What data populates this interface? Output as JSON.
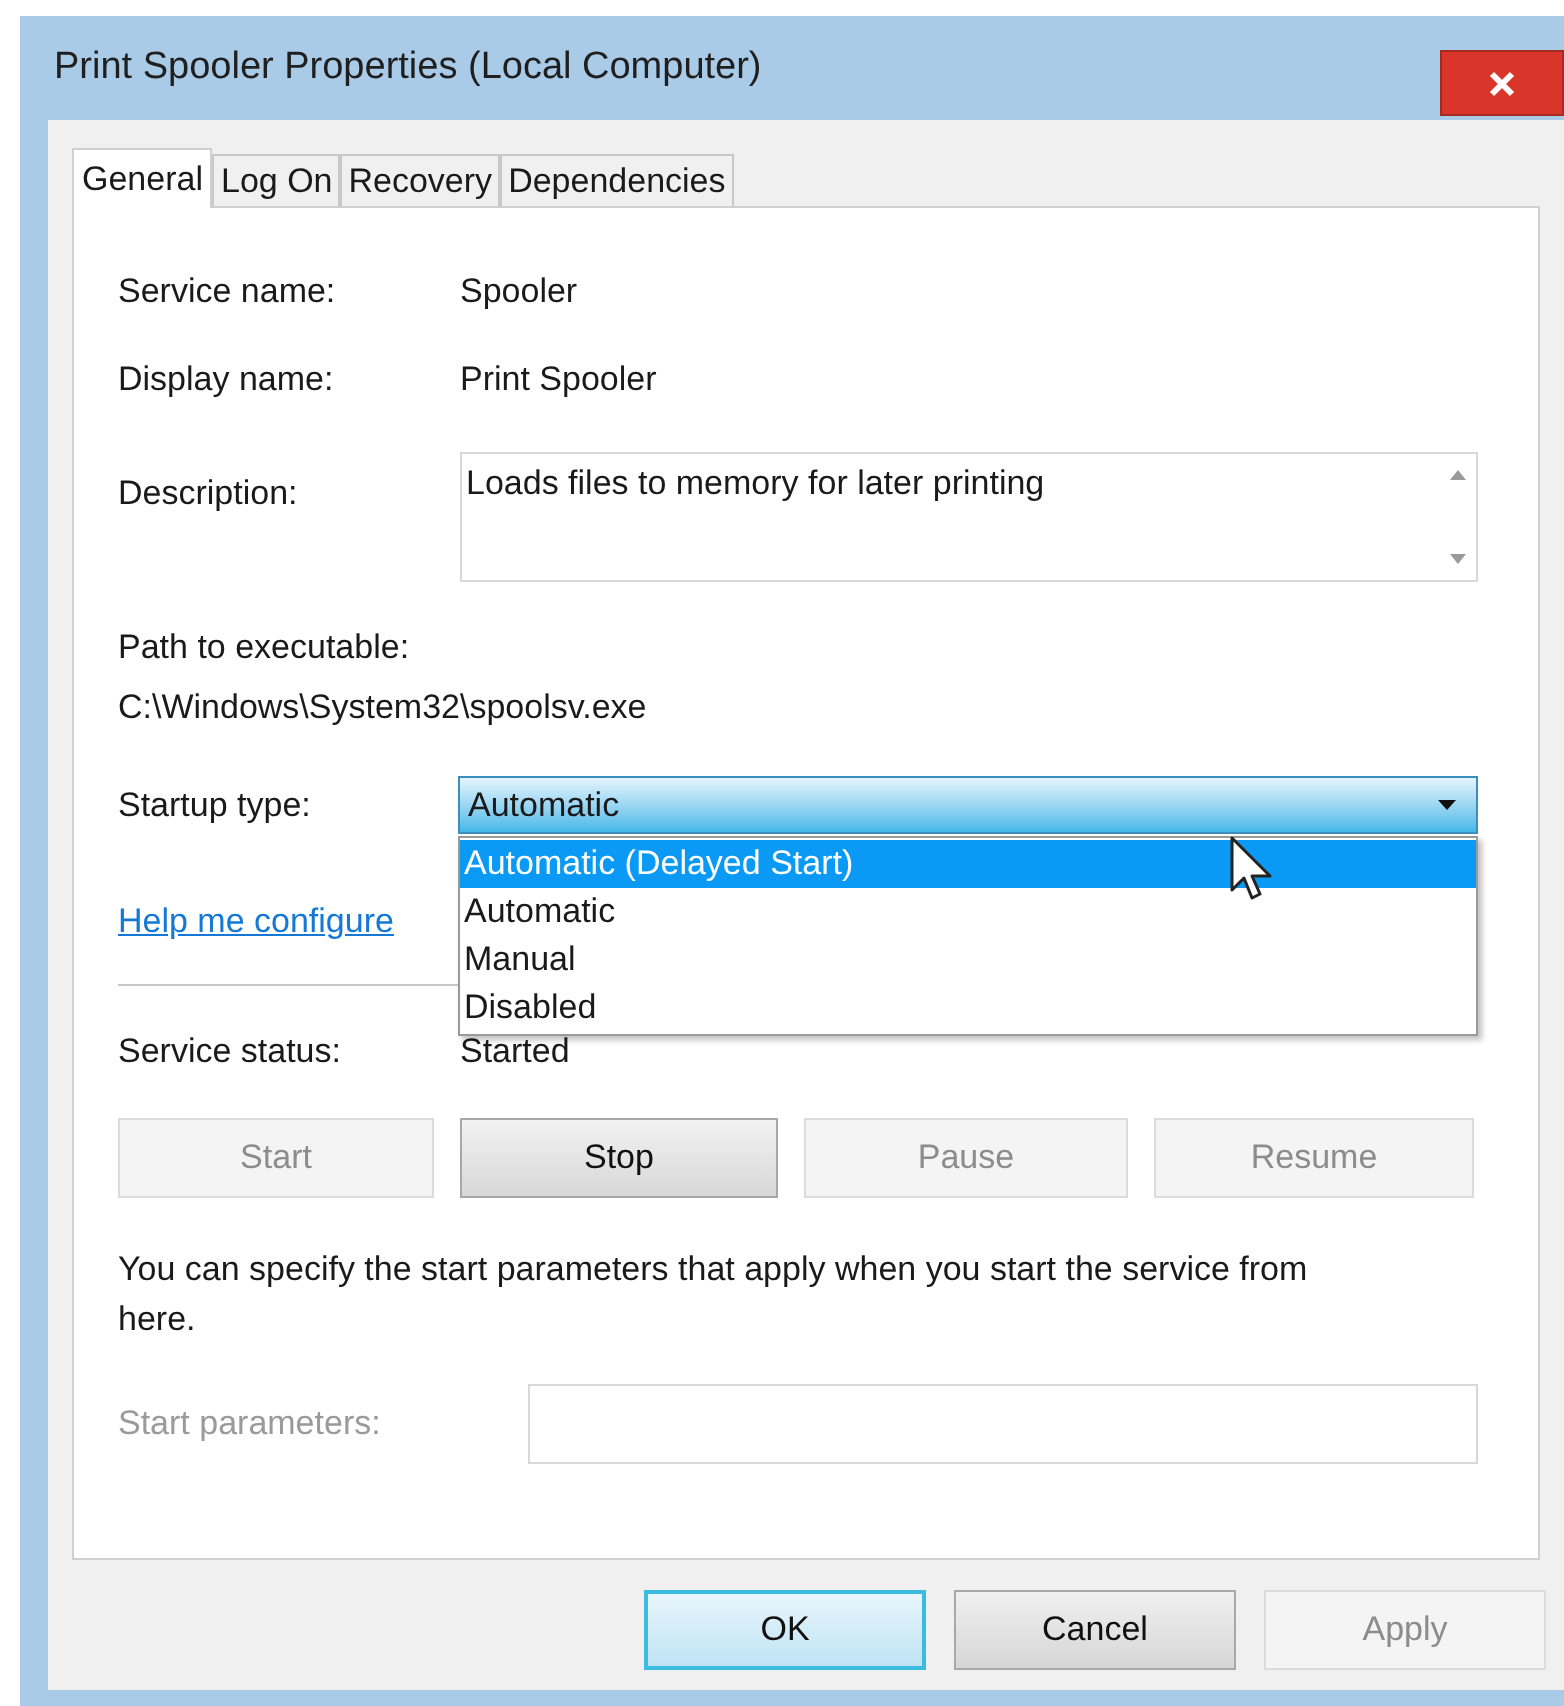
{
  "window": {
    "title": "Print Spooler Properties (Local Computer)"
  },
  "tabs": [
    {
      "label": "General",
      "selected": true
    },
    {
      "label": "Log On",
      "selected": false
    },
    {
      "label": "Recovery",
      "selected": false
    },
    {
      "label": "Dependencies",
      "selected": false
    }
  ],
  "service_name": {
    "label": "Service name:",
    "value": "Spooler"
  },
  "display_name": {
    "label": "Display name:",
    "value": "Print Spooler"
  },
  "description": {
    "label": "Description:",
    "value": "Loads files to memory for later printing"
  },
  "path": {
    "label": "Path to executable:",
    "value": "C:\\Windows\\System32\\spoolsv.exe"
  },
  "startup_type": {
    "label": "Startup type:",
    "value": "Automatic",
    "expanded": true,
    "options": [
      {
        "label": "Automatic (Delayed Start)",
        "highlighted": true
      },
      {
        "label": "Automatic",
        "highlighted": false
      },
      {
        "label": "Manual",
        "highlighted": false
      },
      {
        "label": "Disabled",
        "highlighted": false
      }
    ]
  },
  "help_link": "Help me configure",
  "service_status": {
    "label": "Service status:",
    "value": "Started"
  },
  "service_buttons": [
    {
      "label": "Start",
      "disabled": true
    },
    {
      "label": "Stop",
      "disabled": false
    },
    {
      "label": "Pause",
      "disabled": true
    },
    {
      "label": "Resume",
      "disabled": true
    }
  ],
  "hint": "You can specify the start parameters that apply when you start the service from here.",
  "start_parameters": {
    "label": "Start parameters:",
    "disabled": true
  },
  "dialog_buttons": [
    {
      "label": "OK",
      "kind": "default",
      "disabled": false
    },
    {
      "label": "Cancel",
      "kind": "normal",
      "disabled": false
    },
    {
      "label": "Apply",
      "kind": "normal",
      "disabled": true
    }
  ]
}
